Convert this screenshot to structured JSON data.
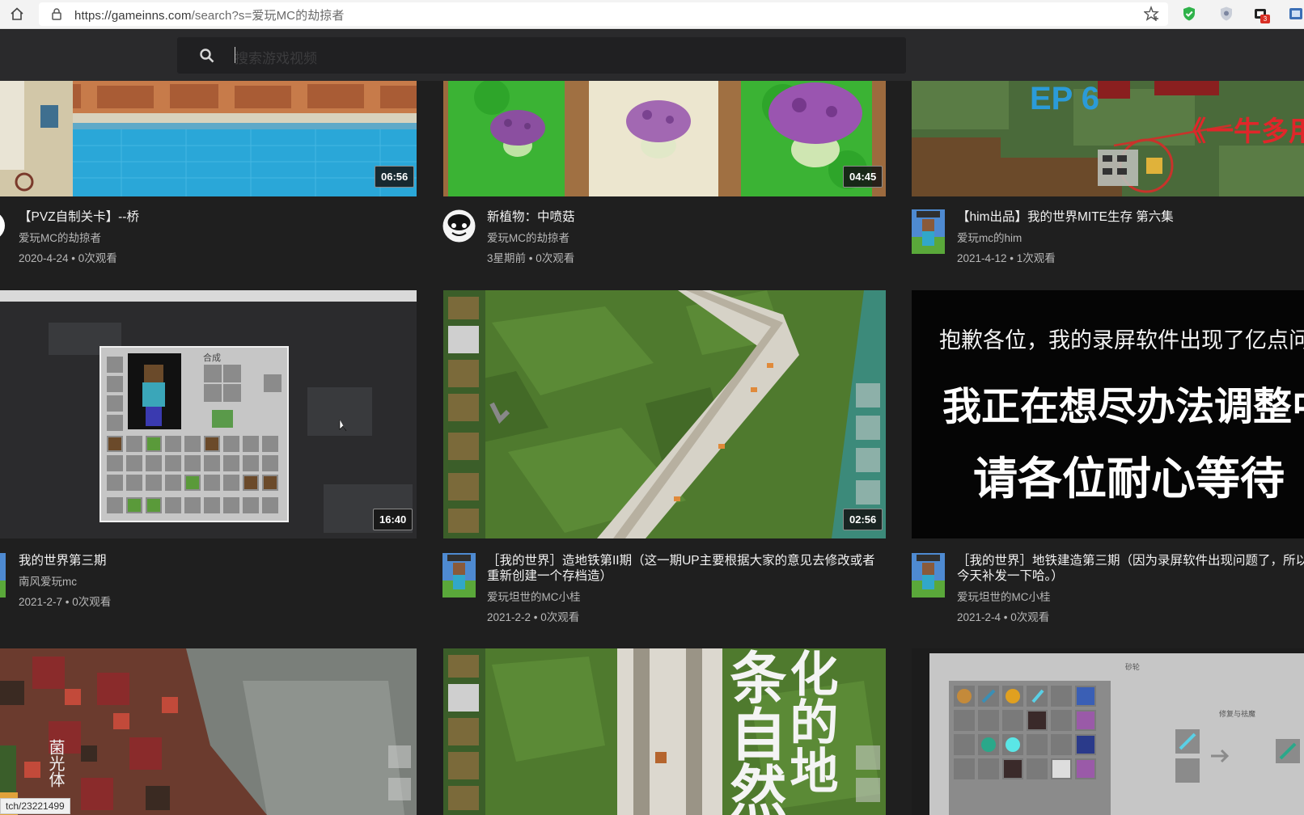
{
  "browser": {
    "url_prefix": "https://gameinns.com",
    "url_rest": "/search?s=爱玩MC的劫掠者",
    "badge": "3"
  },
  "search": {
    "placeholder": "搜索游戏视频"
  },
  "videos": [
    {
      "title": "【PVZ自制关卡】--桥",
      "channel": "爱玩MC的劫掠者",
      "meta": "2020-4-24 • 0次观看",
      "duration": "06:56"
    },
    {
      "title": "新植物：中喷菇",
      "channel": "爱玩MC的劫掠者",
      "meta": "3星期前 • 0次观看",
      "duration": "04:45"
    },
    {
      "title": "【him出品】我的世界MITE生存 第六集",
      "channel": "爱玩mc的him",
      "meta": "2021-4-12 • 1次观看",
      "duration": "",
      "thumb_text": [
        "EP 6",
        "《一牛多用"
      ]
    },
    {
      "title": "我的世界第三期",
      "channel": "南风爱玩mc",
      "meta": "2021-2-7 • 0次观看",
      "duration": "16:40",
      "thumb_text": [
        "合成"
      ]
    },
    {
      "title": "［我的世界］造地铁第II期（这一期UP主要根据大家的意见去修改或者重新创建一个存档造）",
      "channel": "爱玩坦世的MC小桂",
      "meta": "2021-2-2 • 0次观看",
      "duration": "02:56"
    },
    {
      "title": "［我的世界］地铁建造第三期（因为录屏软件出现问题了，所以今天补发一下哈。）",
      "channel": "爱玩坦世的MC小桂",
      "meta": "2021-2-4 • 0次观看",
      "duration": "",
      "thumb_text": [
        "抱歉各位，我的录屏软件出现了亿点问",
        "我正在想尽办法调整中",
        "请各位耐心等待"
      ]
    },
    {
      "title": "",
      "channel": "",
      "meta": "",
      "duration": "",
      "thumb_text": [
        "菌光体"
      ]
    },
    {
      "title": "",
      "channel": "",
      "meta": "",
      "duration": "",
      "thumb_text": [
        "条自然",
        "化的地"
      ]
    },
    {
      "title": "",
      "channel": "",
      "meta": "",
      "duration": "",
      "thumb_text": [
        "砂轮",
        "修复与祛魔"
      ]
    }
  ],
  "status_link": "tch/23221499",
  "colors": {
    "page_bg": "#1f1f1f",
    "header_bg": "#2a2a2c",
    "grass": "#4f7a2e",
    "pool": "#2aa7d8"
  },
  "icons": [
    "home-icon",
    "lock-icon",
    "star-add-icon",
    "shield-check-icon",
    "shield-icon",
    "extension-icon",
    "search-icon",
    "avatar-icon"
  ]
}
